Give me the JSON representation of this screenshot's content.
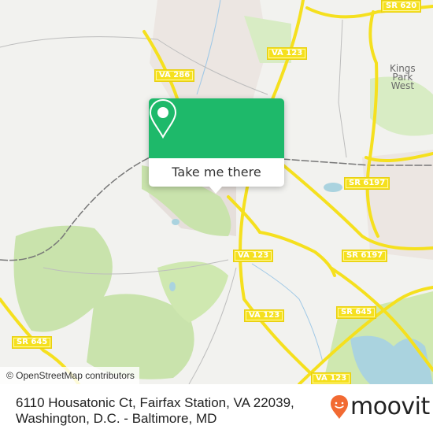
{
  "map": {
    "road_labels": [
      {
        "id": "sr-620",
        "text": "SR 620"
      },
      {
        "id": "va-123-north",
        "text": "VA 123"
      },
      {
        "id": "va-286",
        "text": "VA 286"
      },
      {
        "id": "sr-6197-upper",
        "text": "SR 6197"
      },
      {
        "id": "sr-6197-lower",
        "text": "SR 6197"
      },
      {
        "id": "va-123-center",
        "text": "VA 123"
      },
      {
        "id": "va-123-south",
        "text": "VA 123"
      },
      {
        "id": "va-123-bottom",
        "text": "VA 123"
      },
      {
        "id": "sr-645-west",
        "text": "SR 645"
      },
      {
        "id": "sr-645-east",
        "text": "SR 645"
      }
    ],
    "place_labels": [
      {
        "id": "kings-park-west",
        "lines": [
          "Kings",
          "Park",
          "West"
        ]
      }
    ],
    "attribution": "© OpenStreetMap contributors",
    "colors": {
      "background": "#f2f2ef",
      "park": "#cfe8b0",
      "water": "#aad3df",
      "road": "#f5e01e",
      "residential": "#e8e2de"
    }
  },
  "popup": {
    "icon": "map-pin-icon",
    "button_label": "Take me there",
    "accent_color": "#1eb96a"
  },
  "footer": {
    "address_line1": "6110 Housatonic Ct, Fairfax Station, VA 22039,",
    "address_line2": "Washington, D.C. - Baltimore, MD",
    "logo_text": "moovit",
    "logo_color": "#f26a32"
  }
}
